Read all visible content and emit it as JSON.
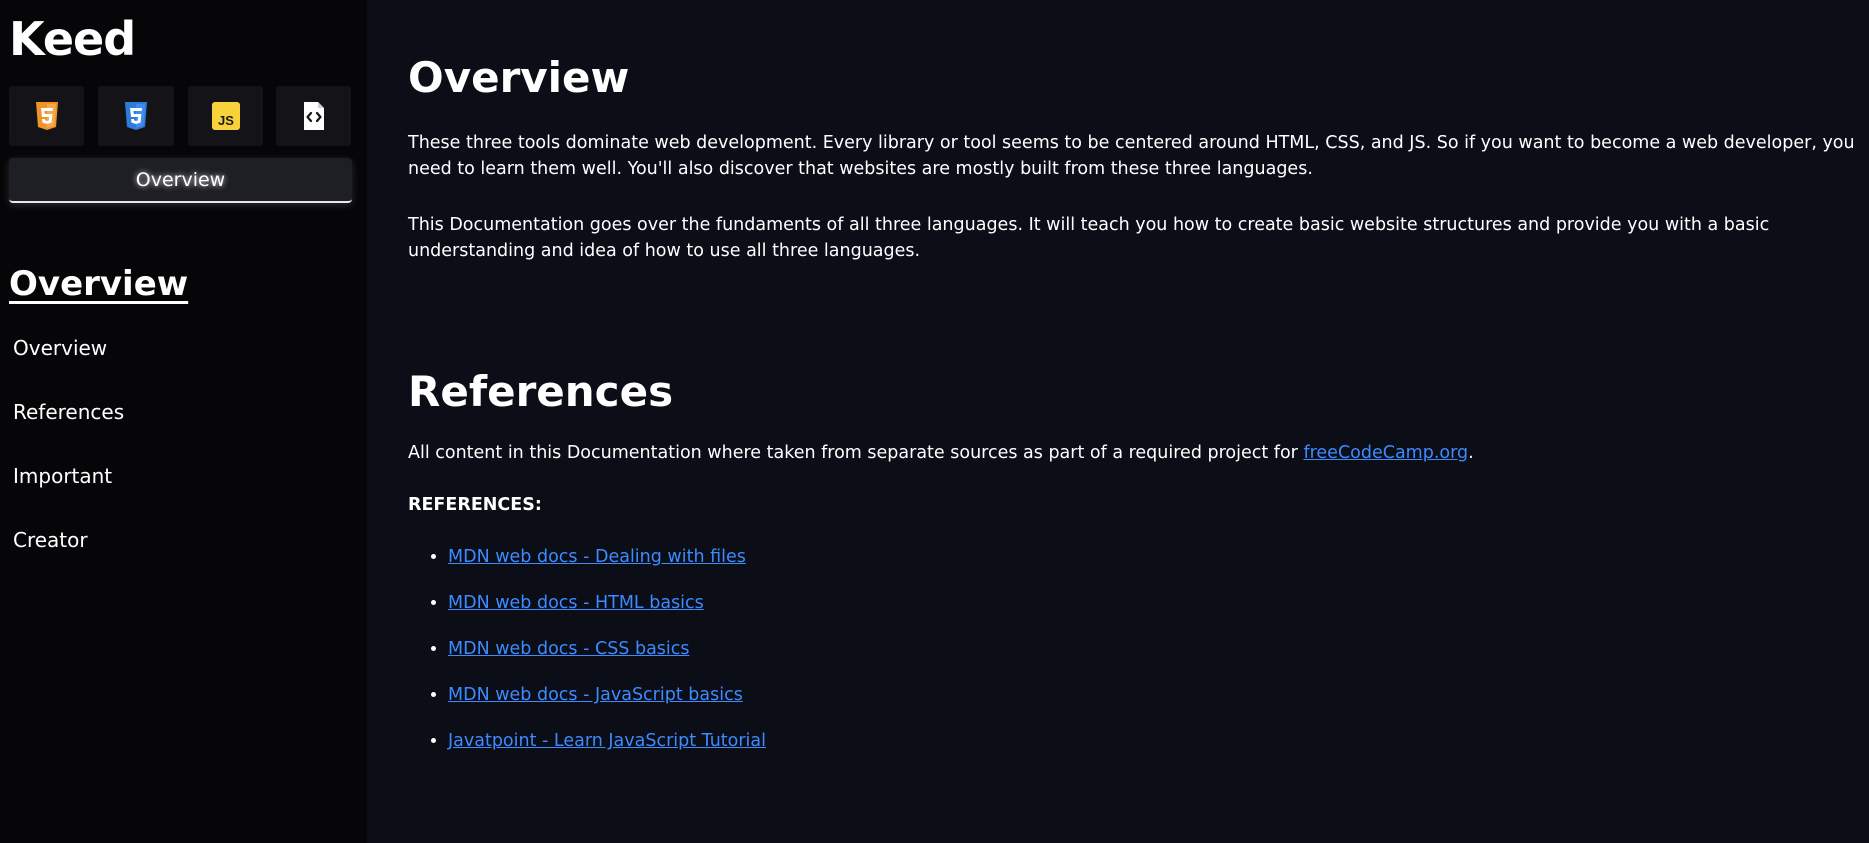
{
  "sidebar": {
    "brand": "Keed",
    "icons": [
      {
        "name": "html5-icon",
        "label": "5",
        "color": "#f0932b"
      },
      {
        "name": "css3-icon",
        "label": "3",
        "color": "#2f7bdc"
      },
      {
        "name": "javascript-icon",
        "label": "JS",
        "color": "#f7d23b"
      },
      {
        "name": "code-file-icon",
        "label": "</>",
        "color": "#ffffff"
      }
    ],
    "active_button": "Overview",
    "nav_heading": "Overview",
    "nav_items": [
      "Overview",
      "References",
      "Important",
      "Creator"
    ]
  },
  "main": {
    "overview": {
      "title": "Overview",
      "paragraphs": [
        "These three tools dominate web development. Every library or tool seems to be centered around HTML, CSS, and JS. So if you want to become a web developer, you need to learn them well. You'll also discover that websites are mostly built from these three languages.",
        "This Documentation goes over the fundaments of all three languages. It will teach you how to create basic website structures and provide you with a basic understanding and idea of how to use all three languages."
      ]
    },
    "references": {
      "title": "References",
      "intro_before": "All content in this Documentation where taken from separate sources as part of a required project for ",
      "intro_link": "freeCodeCamp.org",
      "intro_after": ".",
      "label": "REFERENCES:",
      "links": [
        "MDN web docs - Dealing with files",
        "MDN web docs - HTML basics",
        "MDN web docs - CSS basics",
        "MDN web docs - JavaScript basics",
        "Javatpoint - Learn JavaScript Tutorial"
      ]
    }
  },
  "colors": {
    "sidebar_bg": "#060608",
    "main_bg": "#0b0d17",
    "link": "#3d8bff"
  }
}
